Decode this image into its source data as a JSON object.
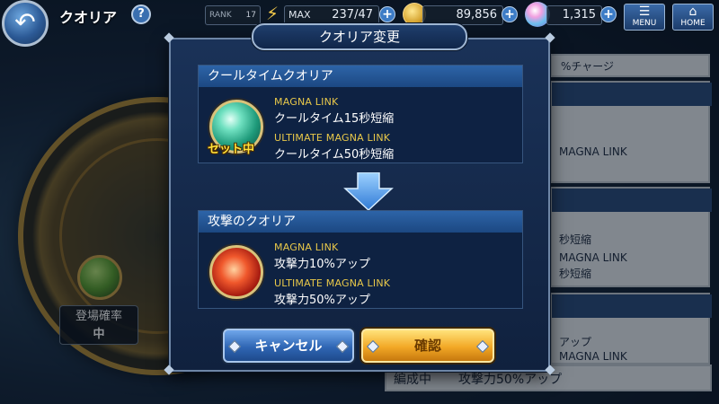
{
  "topbar": {
    "back_icon": "back-arrow-icon",
    "title": "クオリア",
    "help": "?",
    "rank_label": "RANK",
    "rank_value": "17",
    "stamina_label": "MAX",
    "stamina_value": "237/47",
    "coin_value": "89,856",
    "gem_value": "1,315",
    "menu_label": "MENU",
    "home_label": "HOME"
  },
  "background": {
    "drop_rate_label": "登場確率",
    "drop_rate_value": "中",
    "right_panel": {
      "charge_text": "%チャージ",
      "magna_text_1": "MAGNA LINK",
      "magna_text_2": "MAGNA LINK",
      "shorten_text_1": "秒短縮",
      "shorten_text_2": "秒短縮",
      "up_text": "アップ",
      "magna_text_3": "MAGNA LINK",
      "bottom_row": "攻撃力50%アップ",
      "bottom_prefix": "編成中"
    }
  },
  "dialog": {
    "title": "クオリア変更",
    "current": {
      "header": "クールタイムクオリア",
      "badge": "セット中",
      "link_label": "MAGNA LINK",
      "link_value": "クールタイム15秒短縮",
      "ult_label": "ULTIMATE MAGNA LINK",
      "ult_value": "クールタイム50秒短縮",
      "orb_icon": "teal-quaria-orb-icon"
    },
    "next": {
      "header": "攻撃のクオリア",
      "link_label": "MAGNA LINK",
      "link_value": "攻撃力10%アップ",
      "ult_label": "ULTIMATE MAGNA LINK",
      "ult_value": "攻撃力50%アップ",
      "orb_icon": "red-quaria-orb-icon"
    },
    "cancel_label": "キャンセル",
    "confirm_label": "確認"
  },
  "colors": {
    "accent_gold": "#e8c84a",
    "header_blue": "#2d64a8",
    "confirm_gold": "#f2a826",
    "cancel_blue": "#2f66b4"
  }
}
